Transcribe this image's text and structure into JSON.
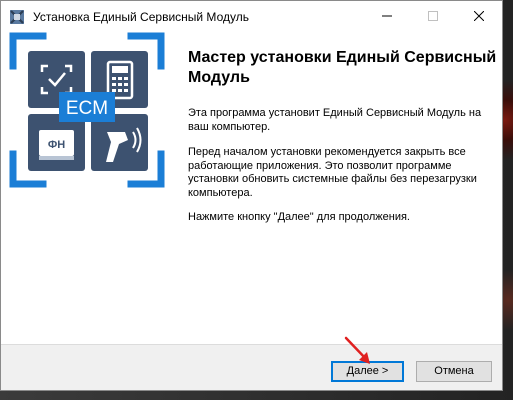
{
  "window": {
    "title": "Установка Единый Сервисный Модуль"
  },
  "banner": {
    "logo_text": "ECM",
    "fn_label": "ФН"
  },
  "content": {
    "heading": "Мастер установки Единый Сервисный Модуль",
    "paragraph1": "Эта программа установит Единый Сервисный Модуль на ваш компьютер.",
    "paragraph2": "Перед началом установки рекомендуется закрыть все работающие приложения. Это позволит программе установки обновить системные файлы без перезагрузки компьютера.",
    "paragraph3": "Нажмите кнопку \"Далее\" для продолжения."
  },
  "buttons": {
    "next_label": "Далее >",
    "cancel_label": "Отмена"
  },
  "colors": {
    "accent": "#0078d7",
    "tile": "#3d5270",
    "frame": "#1b7ed6",
    "annotation_arrow": "#e02020"
  }
}
